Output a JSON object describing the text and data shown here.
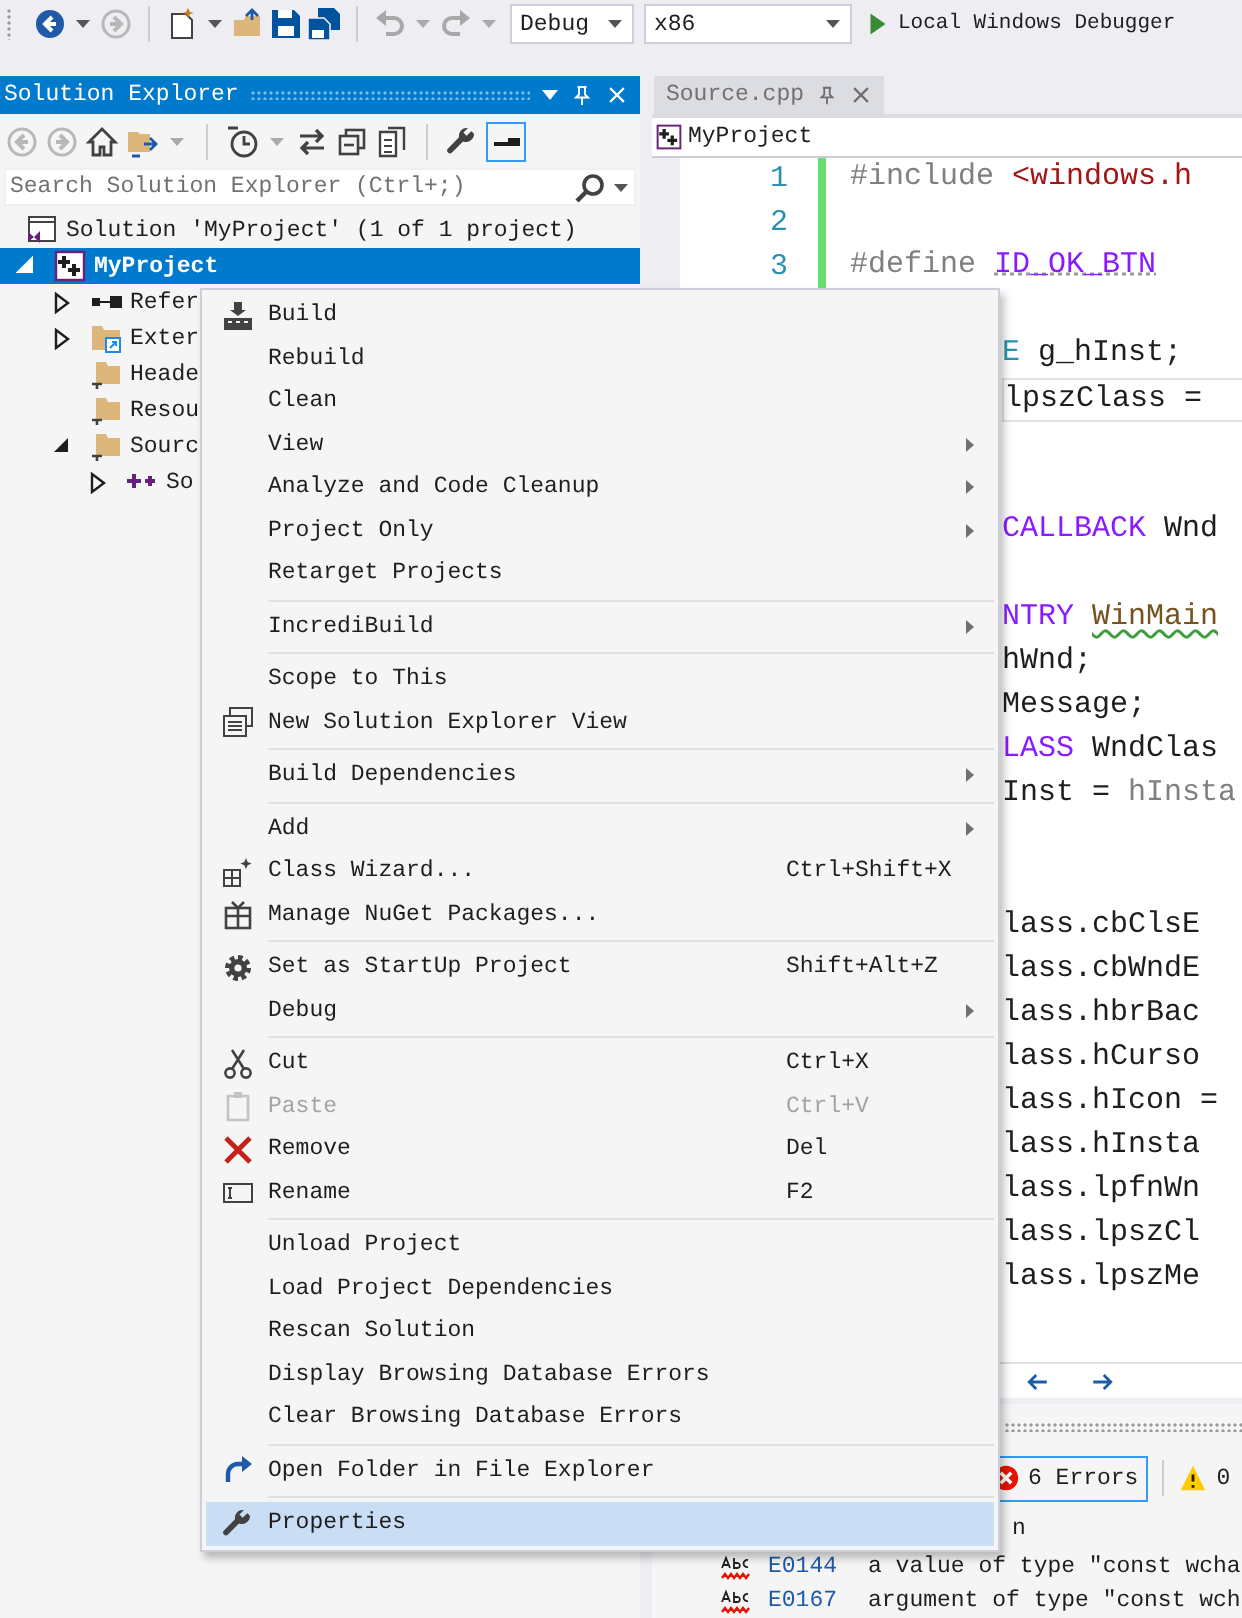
{
  "toolbar": {
    "configuration": "Debug",
    "platform": "x86",
    "run_label": "Local Windows Debugger"
  },
  "solution_explorer": {
    "title": "Solution Explorer",
    "search": {
      "placeholder": "Search Solution Explorer (Ctrl+;)"
    },
    "tree": [
      {
        "label": "Solution 'MyProject' (1 of 1 project)",
        "kind": "solution",
        "selected": false,
        "children": [
          {
            "label": "MyProject",
            "kind": "project",
            "selected": true,
            "expanded": true,
            "children": [
              {
                "label": "Refer",
                "kind": "references",
                "selected": false,
                "expanded": false
              },
              {
                "label": "Exter",
                "kind": "external",
                "selected": false,
                "expanded": false
              },
              {
                "label": "Heade",
                "kind": "folder",
                "selected": false
              },
              {
                "label": "Resou",
                "kind": "folder",
                "selected": false
              },
              {
                "label": "Sourc",
                "kind": "folder",
                "selected": false,
                "expanded": true,
                "children": [
                  {
                    "label": "So",
                    "kind": "file",
                    "selected": false,
                    "expanded": false
                  }
                ]
              }
            ]
          }
        ]
      }
    ]
  },
  "editor": {
    "tab": "Source.cpp",
    "navigation": "MyProject",
    "lines": [
      {
        "kind": "full",
        "number": "1",
        "current": false,
        "segments": [
          {
            "kind": "pp",
            "text": "#include "
          },
          {
            "kind": "str",
            "text": "<windows.h"
          }
        ]
      },
      {
        "kind": "full",
        "number": "2",
        "current": false
      },
      {
        "kind": "full",
        "number": "3",
        "current": false,
        "segments": [
          {
            "kind": "pp",
            "text": "#define "
          },
          {
            "kind": "macro",
            "text": "ID_OK_BTN",
            "dotted": true
          }
        ]
      },
      {
        "kind": "partial",
        "current": false
      },
      {
        "kind": "partial",
        "current": false,
        "segments": [
          {
            "kind": "type",
            "text": "E"
          },
          {
            "kind": "plain",
            "text": " g_hInst;"
          }
        ]
      },
      {
        "kind": "partial",
        "current": true,
        "segments": [
          {
            "kind": "plain",
            "text": "lpszClass ="
          }
        ]
      },
      {
        "kind": "partial",
        "current": false
      },
      {
        "kind": "partial",
        "current": false
      },
      {
        "kind": "partial",
        "current": false,
        "segments": [
          {
            "kind": "macro",
            "text": "CALLBACK"
          },
          {
            "kind": "plain",
            "text": " Wnd"
          }
        ]
      },
      {
        "kind": "partial",
        "current": false
      },
      {
        "kind": "partial",
        "current": false,
        "segments": [
          {
            "kind": "macro",
            "text": "NTRY "
          },
          {
            "kind": "fn",
            "text": "WinMain",
            "squiggle": true
          }
        ]
      },
      {
        "kind": "partial",
        "current": false,
        "segments": [
          {
            "kind": "plain",
            "text": "hWnd;"
          }
        ]
      },
      {
        "kind": "partial",
        "current": false,
        "segments": [
          {
            "kind": "plain",
            "text": "Message;"
          }
        ]
      },
      {
        "kind": "partial",
        "current": false,
        "segments": [
          {
            "kind": "macro",
            "text": "LASS"
          },
          {
            "kind": "plain",
            "text": " WndClas"
          }
        ]
      },
      {
        "kind": "partial",
        "current": false,
        "segments": [
          {
            "kind": "plain",
            "text": "Inst = "
          },
          {
            "kind": "param",
            "text": "hInsta"
          }
        ]
      },
      {
        "kind": "partial",
        "current": false
      },
      {
        "kind": "partial",
        "current": false
      },
      {
        "kind": "partial",
        "current": false,
        "segments": [
          {
            "kind": "plain",
            "text": "lass.cbClsE"
          }
        ]
      },
      {
        "kind": "partial",
        "current": false,
        "segments": [
          {
            "kind": "plain",
            "text": "lass.cbWndE"
          }
        ]
      },
      {
        "kind": "partial",
        "current": false,
        "segments": [
          {
            "kind": "plain",
            "text": "lass.hbrBac"
          }
        ]
      },
      {
        "kind": "partial",
        "current": false,
        "segments": [
          {
            "kind": "plain",
            "text": "lass.hCurso"
          }
        ]
      },
      {
        "kind": "partial",
        "current": false,
        "segments": [
          {
            "kind": "plain",
            "text": "lass.hIcon ="
          }
        ]
      },
      {
        "kind": "partial",
        "current": false,
        "segments": [
          {
            "kind": "plain",
            "text": "lass.hInsta"
          }
        ]
      },
      {
        "kind": "partial",
        "current": false,
        "segments": [
          {
            "kind": "plain",
            "text": "lass.lpfnWn"
          }
        ]
      },
      {
        "kind": "partial",
        "current": false,
        "segments": [
          {
            "kind": "plain",
            "text": "lass.lpszCl"
          }
        ]
      },
      {
        "kind": "partial",
        "current": false,
        "segments": [
          {
            "kind": "plain",
            "text": "lass.lpszMe"
          }
        ]
      }
    ]
  },
  "error_list": {
    "errors_button": "6 Errors",
    "warnings_button": "0",
    "header": "n",
    "rows": [
      {
        "code": "E0144",
        "description": "a value of type \"const wcha"
      },
      {
        "code": "E0167",
        "description": "argument of type \"const wch"
      }
    ]
  },
  "menu": {
    "groups": [
      {
        "items": [
          {
            "label": "Build",
            "selected": false,
            "disabled": false,
            "submenu": false
          },
          {
            "label": "Rebuild",
            "selected": false,
            "disabled": false,
            "submenu": false
          },
          {
            "label": "Clean",
            "selected": false,
            "disabled": false,
            "submenu": false
          },
          {
            "label": "View",
            "selected": false,
            "disabled": false,
            "submenu": true
          },
          {
            "label": "Analyze and Code Cleanup",
            "selected": false,
            "disabled": false,
            "submenu": true
          },
          {
            "label": "Project Only",
            "selected": false,
            "disabled": false,
            "submenu": true
          },
          {
            "label": "Retarget Projects",
            "selected": false,
            "disabled": false,
            "submenu": false
          }
        ]
      },
      {
        "items": [
          {
            "label": "IncrediBuild",
            "selected": false,
            "disabled": false,
            "submenu": true
          }
        ]
      },
      {
        "items": [
          {
            "label": "Scope to This",
            "selected": false,
            "disabled": false,
            "submenu": false
          },
          {
            "label": "New Solution Explorer View",
            "selected": false,
            "disabled": false,
            "submenu": false
          }
        ]
      },
      {
        "items": [
          {
            "label": "Build Dependencies",
            "selected": false,
            "disabled": false,
            "submenu": true
          }
        ]
      },
      {
        "items": [
          {
            "label": "Add",
            "selected": false,
            "disabled": false,
            "submenu": true
          },
          {
            "label": "Class Wizard...",
            "shortcut": "Ctrl+Shift+X",
            "selected": false,
            "disabled": false,
            "submenu": false
          },
          {
            "label": "Manage NuGet Packages...",
            "selected": false,
            "disabled": false,
            "submenu": false
          }
        ]
      },
      {
        "items": [
          {
            "label": "Set as StartUp Project",
            "shortcut": "Shift+Alt+Z",
            "selected": false,
            "disabled": false,
            "submenu": false
          },
          {
            "label": "Debug",
            "selected": false,
            "disabled": false,
            "submenu": true
          }
        ]
      },
      {
        "items": [
          {
            "label": "Cut",
            "shortcut": "Ctrl+X",
            "selected": false,
            "disabled": false,
            "submenu": false
          },
          {
            "label": "Paste",
            "shortcut": "Ctrl+V",
            "selected": false,
            "disabled": true,
            "submenu": false
          },
          {
            "label": "Remove",
            "shortcut": "Del",
            "selected": false,
            "disabled": false,
            "submenu": false
          },
          {
            "label": "Rename",
            "shortcut": "F2",
            "selected": false,
            "disabled": false,
            "submenu": false
          }
        ]
      },
      {
        "items": [
          {
            "label": "Unload Project",
            "selected": false,
            "disabled": false,
            "submenu": false
          },
          {
            "label": "Load Project Dependencies",
            "selected": false,
            "disabled": false,
            "submenu": false
          },
          {
            "label": "Rescan Solution",
            "selected": false,
            "disabled": false,
            "submenu": false
          },
          {
            "label": "Display Browsing Database Errors",
            "selected": false,
            "disabled": false,
            "submenu": false
          },
          {
            "label": "Clear Browsing Database Errors",
            "selected": false,
            "disabled": false,
            "submenu": false
          }
        ]
      },
      {
        "items": [
          {
            "label": "Open Folder in File Explorer",
            "selected": false,
            "disabled": false,
            "submenu": false
          }
        ]
      },
      {
        "items": [
          {
            "label": "Properties",
            "selected": true,
            "disabled": false,
            "submenu": false
          }
        ]
      }
    ]
  }
}
